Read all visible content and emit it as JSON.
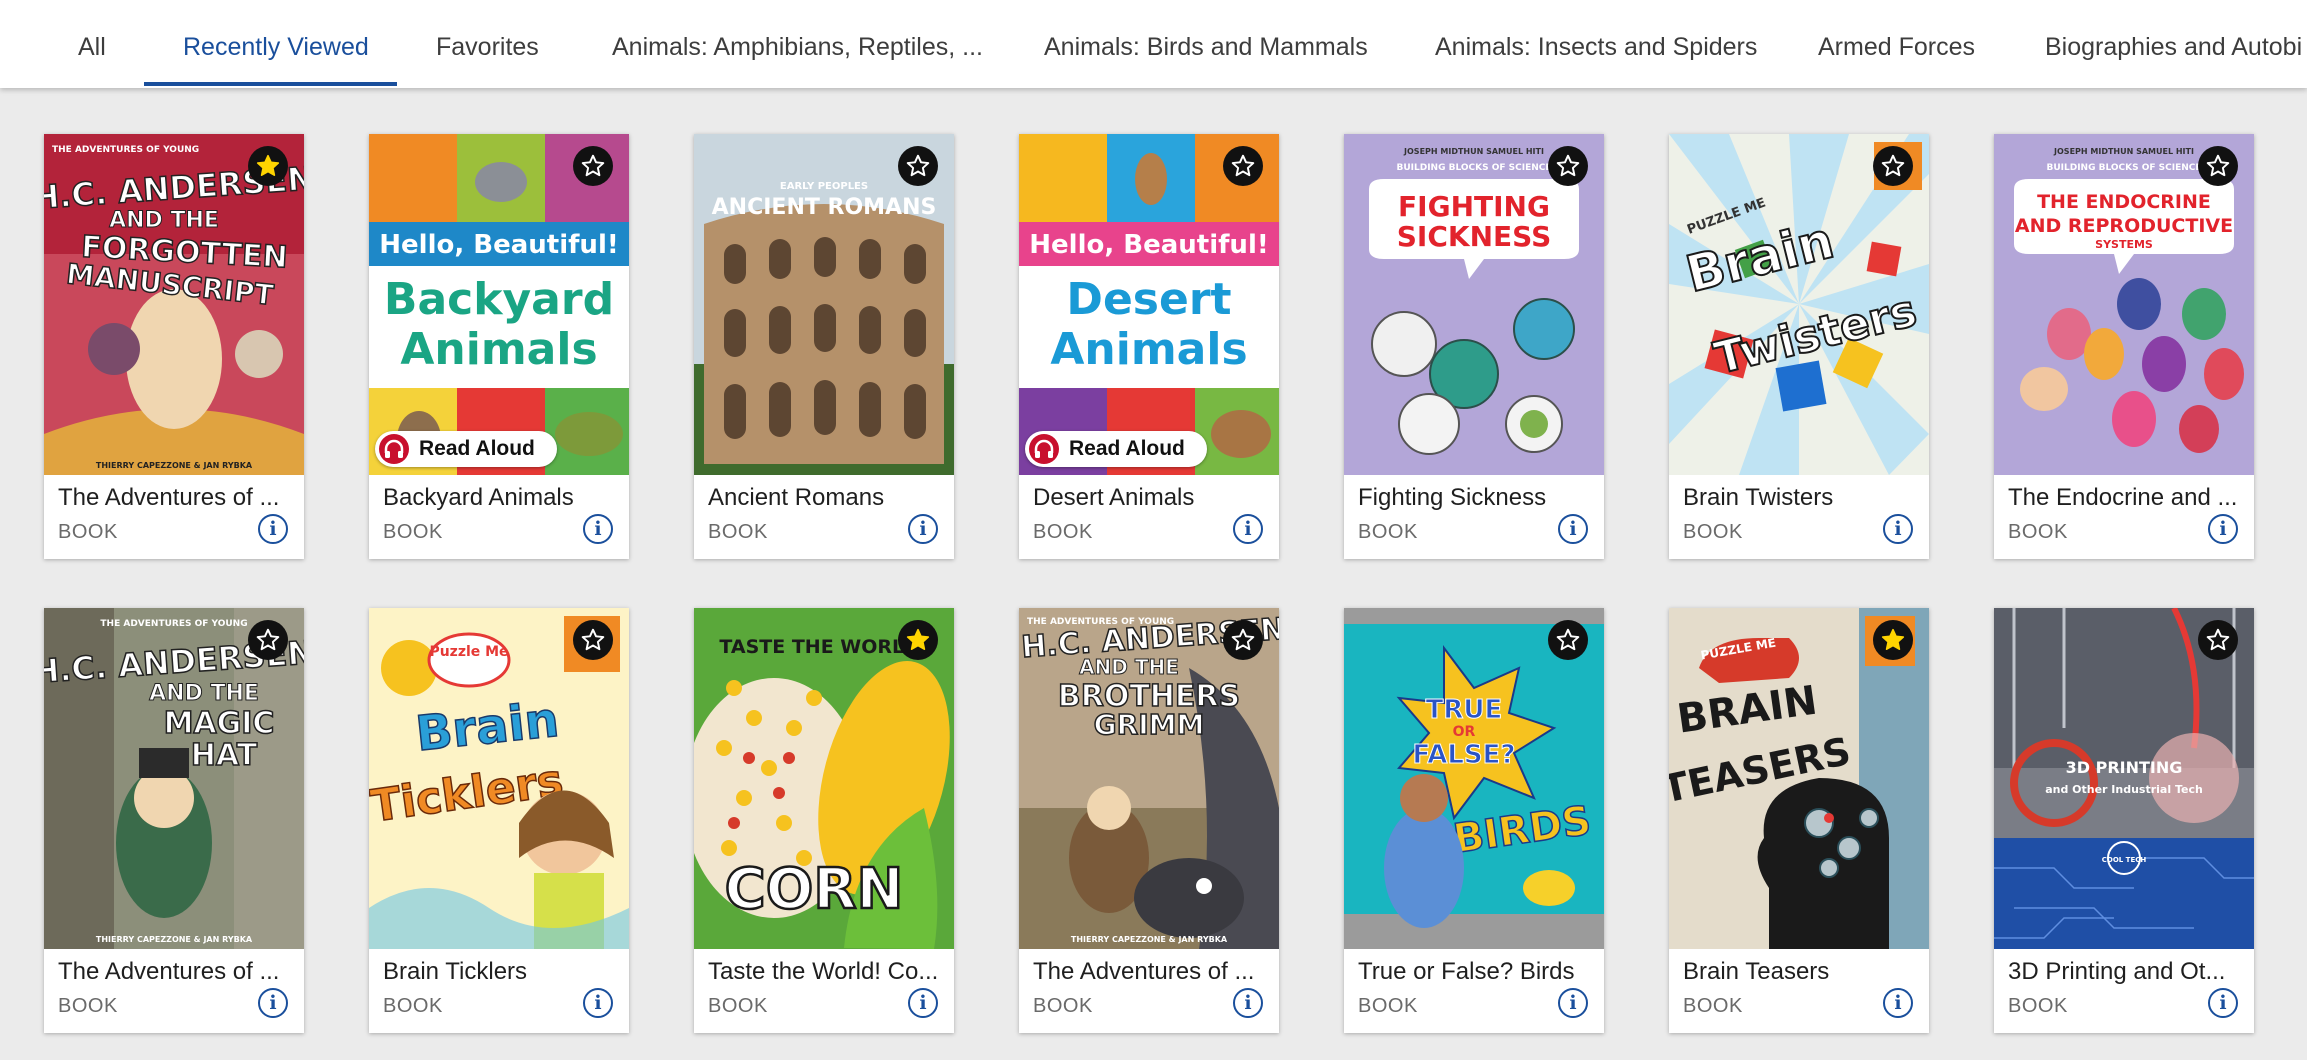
{
  "tabs": [
    {
      "label": "All"
    },
    {
      "label": "Recently Viewed",
      "active": true
    },
    {
      "label": "Favorites"
    },
    {
      "label": "Animals: Amphibians, Reptiles, ..."
    },
    {
      "label": "Animals: Birds and Mammals"
    },
    {
      "label": "Animals: Insects and Spiders"
    },
    {
      "label": "Armed Forces"
    },
    {
      "label": "Biographies and Autobi"
    }
  ],
  "read_aloud_label": "Read Aloud",
  "colors": {
    "accent": "#1a4f9c",
    "favorite_star": "#ffd400",
    "read_aloud": "#c8102e"
  },
  "cards": [
    {
      "title": "The Adventures of ...",
      "type": "BOOK",
      "favorited": true,
      "cover": {
        "lines": [
          "THE ADVENTURES OF YOUNG",
          "H.C. ANDERSEN",
          "AND THE",
          "FORGOTTEN",
          "MANUSCRIPT"
        ],
        "credit": "THIERRY CAPEZZONE & JAN RYBKA"
      }
    },
    {
      "title": "Backyard Animals",
      "type": "BOOK",
      "favorited": false,
      "read_aloud": true,
      "cover": {
        "banner": "Hello, Beautiful!",
        "lines": [
          "Backyard",
          "Animals"
        ]
      }
    },
    {
      "title": "Ancient Romans",
      "type": "BOOK",
      "favorited": false,
      "cover": {
        "series": "EARLY PEOPLES",
        "lines": [
          "ANCIENT ROMANS"
        ]
      }
    },
    {
      "title": "Desert Animals",
      "type": "BOOK",
      "favorited": false,
      "read_aloud": true,
      "cover": {
        "banner": "Hello, Beautiful!",
        "lines": [
          "Desert",
          "Animals"
        ]
      }
    },
    {
      "title": "Fighting Sickness",
      "type": "BOOK",
      "favorited": false,
      "cover": {
        "authors": "JOSEPH MIDTHUN   SAMUEL HITI",
        "series": "BUILDING BLOCKS OF SCIENCE",
        "lines": [
          "FIGHTING",
          "SICKNESS"
        ]
      }
    },
    {
      "title": "Brain Twisters",
      "type": "BOOK",
      "favorited": false,
      "cover": {
        "series": "PUZZLE ME",
        "lines": [
          "Brain",
          "Twisters"
        ]
      }
    },
    {
      "title": "The Endocrine and ...",
      "type": "BOOK",
      "favorited": false,
      "cover": {
        "authors": "JOSEPH MIDTHUN   SAMUEL HITI",
        "series": "BUILDING BLOCKS OF SCIENCE",
        "lines": [
          "THE ENDOCRINE",
          "AND REPRODUCTIVE",
          "SYSTEMS"
        ]
      }
    },
    {
      "title": "The Adventures of ...",
      "type": "BOOK",
      "favorited": false,
      "cover": {
        "lines": [
          "THE ADVENTURES OF YOUNG",
          "H.C. ANDERSEN",
          "AND THE",
          "MAGIC",
          "HAT"
        ],
        "credit": "THIERRY CAPEZZONE & JAN RYBKA"
      }
    },
    {
      "title": "Brain Ticklers",
      "type": "BOOK",
      "favorited": false,
      "cover": {
        "series": "Puzzle Me",
        "lines": [
          "Brain",
          "Ticklers"
        ]
      }
    },
    {
      "title": "Taste the World! Co...",
      "type": "BOOK",
      "favorited": true,
      "cover": {
        "series": "TASTE THE WORLD!",
        "lines": [
          "CORN"
        ]
      }
    },
    {
      "title": "The Adventures of ...",
      "type": "BOOK",
      "favorited": false,
      "cover": {
        "lines": [
          "THE ADVENTURES OF YOUNG",
          "H.C. ANDERSEN",
          "AND THE",
          "BROTHERS",
          "GRIMM"
        ],
        "credit": "THIERRY CAPEZZONE & JAN RYBKA"
      }
    },
    {
      "title": "True or False? Birds",
      "type": "BOOK",
      "favorited": false,
      "cover": {
        "lines": [
          "TRUE",
          "OR",
          "FALSE?",
          "BIRDS"
        ]
      }
    },
    {
      "title": "Brain Teasers",
      "type": "BOOK",
      "favorited": true,
      "cover": {
        "series": "PUZZLE ME",
        "lines": [
          "BRAIN",
          "TEASERS"
        ]
      }
    },
    {
      "title": "3D Printing and Ot...",
      "type": "BOOK",
      "favorited": false,
      "cover": {
        "lines": [
          "3D PRINTING",
          "and Other Industrial Tech"
        ],
        "series": "COOL TECH"
      }
    }
  ]
}
